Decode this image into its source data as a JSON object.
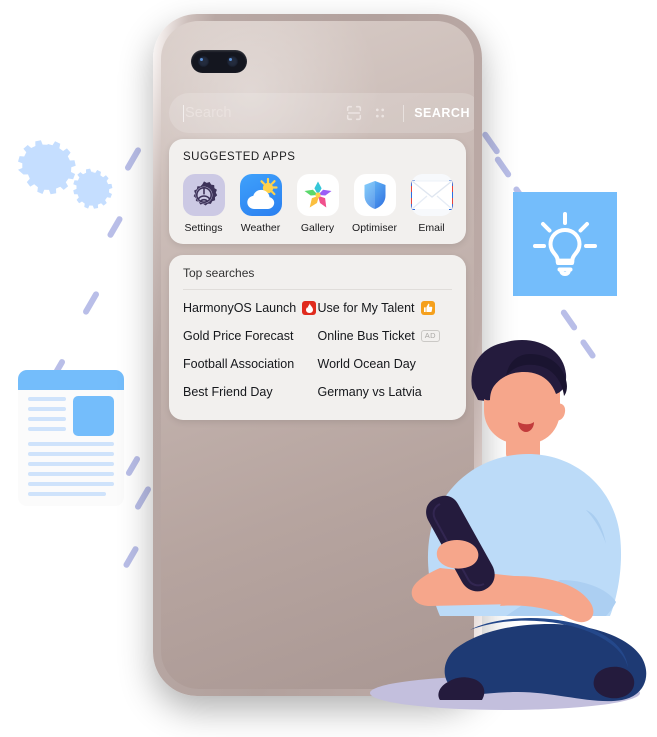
{
  "device": {
    "name": "smartphone-mockup",
    "body_color": "#b2a19d",
    "screen_color": "#c1b2ad"
  },
  "search": {
    "placeholder": "Search",
    "value": "",
    "scan_icon": "scan-viewfinder-icon",
    "qr_icon": "qr-dots-icon",
    "button_label": "SEARCH"
  },
  "suggested_apps": {
    "title": "SUGGESTED APPS",
    "items": [
      {
        "label": "Settings",
        "icon": "gear-icon"
      },
      {
        "label": "Weather",
        "icon": "sun-cloud-icon"
      },
      {
        "label": "Gallery",
        "icon": "flower-petals-icon"
      },
      {
        "label": "Optimiser",
        "icon": "shield-icon"
      },
      {
        "label": "Email",
        "icon": "envelope-icon"
      }
    ]
  },
  "top_searches": {
    "title": "Top searches",
    "items": [
      {
        "label": "HarmonyOS Launch",
        "badge": "hot"
      },
      {
        "label": "Use for My Talent",
        "badge": "up"
      },
      {
        "label": "Gold Price Forecast",
        "badge": ""
      },
      {
        "label": "Online Bus Ticket",
        "badge": "ad",
        "badge_text": "AD"
      },
      {
        "label": "Football Association",
        "badge": ""
      },
      {
        "label": "World Ocean Day",
        "badge": ""
      },
      {
        "label": "Best Friend Day",
        "badge": ""
      },
      {
        "label": "Germany vs Latvia",
        "badge": ""
      }
    ]
  },
  "decorations": {
    "gears": "gears-icon",
    "lightbulb": "lightbulb-icon",
    "lightbulb_tile_color": "#74bdfb",
    "newspaper": "newspaper-icon",
    "person": "person-using-phone-illustration",
    "dash_color": "#b9bee8",
    "accent_blue": "#74bdfb",
    "accent_light_blue": "#c5deff",
    "skin": "#f6a68b",
    "hair": "#241b3d",
    "pants": "#1e3a74"
  }
}
